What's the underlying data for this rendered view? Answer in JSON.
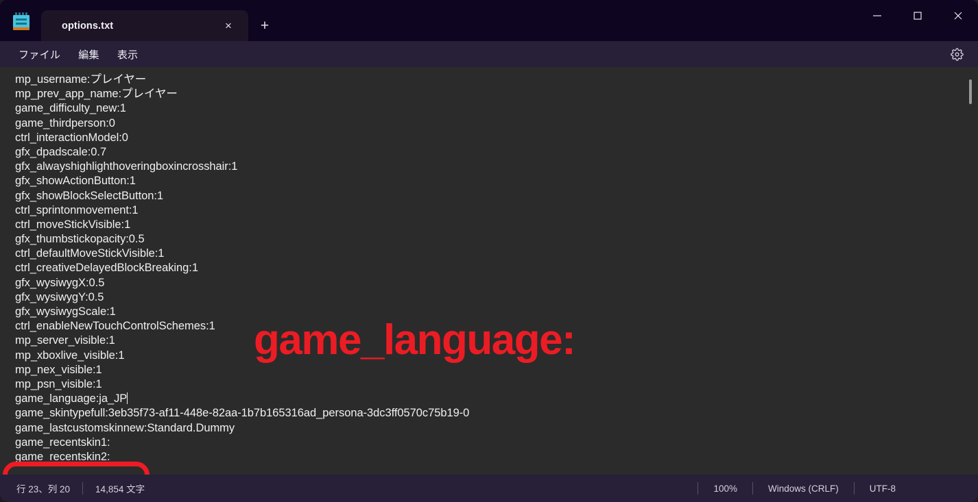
{
  "window": {
    "app_icon": "notepad-icon",
    "controls": {
      "minimize": "minimize-icon",
      "maximize": "maximize-icon",
      "close": "close-icon"
    }
  },
  "tabs": [
    {
      "title": "options.txt",
      "close": "×",
      "active": true
    }
  ],
  "newtab_label": "+",
  "menu": {
    "items": [
      "ファイル",
      "編集",
      "表示"
    ],
    "settings_icon": "gear-icon"
  },
  "editor": {
    "lines": [
      "mp_username:プレイヤー",
      "mp_prev_app_name:プレイヤー",
      "game_difficulty_new:1",
      "game_thirdperson:0",
      "ctrl_interactionModel:0",
      "gfx_dpadscale:0.7",
      "gfx_alwayshighlighthoveringboxincrosshair:1",
      "gfx_showActionButton:1",
      "gfx_showBlockSelectButton:1",
      "ctrl_sprintonmovement:1",
      "ctrl_moveStickVisible:1",
      "gfx_thumbstickopacity:0.5",
      "ctrl_defaultMoveStickVisible:1",
      "ctrl_creativeDelayedBlockBreaking:1",
      "gfx_wysiwygX:0.5",
      "gfx_wysiwygY:0.5",
      "gfx_wysiwygScale:1",
      "ctrl_enableNewTouchControlSchemes:1",
      "mp_server_visible:1",
      "mp_xboxlive_visible:1",
      "mp_nex_visible:1",
      "mp_psn_visible:1"
    ],
    "cursor_line": "game_language:ja_JP",
    "lines_after": [
      "game_skintypefull:3eb35f73-af11-448e-82aa-1b7b165316ad_persona-3dc3ff0570c75b19-0",
      "game_lastcustomskinnew:Standard.Dummy",
      "game_recentskin1:",
      "game_recentskin2:"
    ]
  },
  "annotation": {
    "overlay_text": "game_language:",
    "overlay_color": "#ec1c24",
    "oval_color": "#ee1b24"
  },
  "statusbar": {
    "position": "行 23、列 20",
    "char_count": "14,854 文字",
    "zoom": "100%",
    "line_ending": "Windows (CRLF)",
    "encoding": "UTF-8"
  }
}
